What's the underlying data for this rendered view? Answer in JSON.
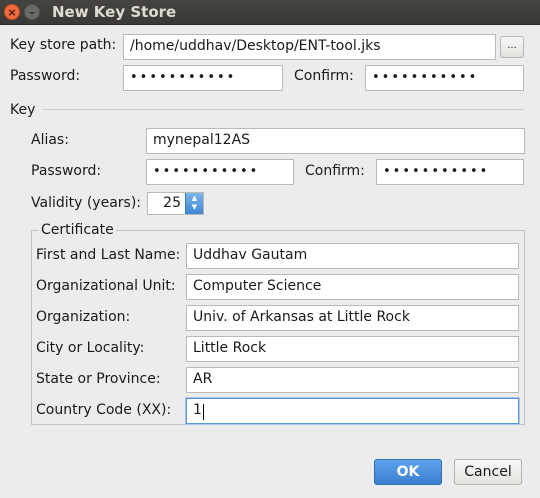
{
  "window": {
    "title": "New Key Store",
    "close_glyph": "×",
    "minimize_glyph": "–"
  },
  "keystore": {
    "path_label": "Key store path:",
    "path_value": "/home/uddhav/Desktop/ENT-tool.jks",
    "browse_label": "...",
    "password_label": "Password:",
    "password_value": "•••••••••••",
    "confirm_label": "Confirm:",
    "confirm_value": "•••••••••••"
  },
  "key": {
    "section_label": "Key",
    "alias_label": "Alias:",
    "alias_value": "mynepal12AS",
    "password_label": "Password:",
    "password_value": "•••••••••••",
    "confirm_label": "Confirm:",
    "confirm_value": "•••••••••••",
    "validity_label": "Validity (years):",
    "validity_value": "25",
    "spin_up": "▲",
    "spin_down": "▼"
  },
  "certificate": {
    "section_label": "Certificate",
    "fields": [
      {
        "label": "First and Last Name:",
        "value": "Uddhav Gautam"
      },
      {
        "label": "Organizational Unit:",
        "value": "Computer Science"
      },
      {
        "label": "Organization:",
        "value": "Univ. of Arkansas at Little Rock"
      },
      {
        "label": "City or Locality:",
        "value": "Little Rock"
      },
      {
        "label": "State or Province:",
        "value": "AR"
      },
      {
        "label": "Country Code (XX):",
        "value": "1"
      }
    ]
  },
  "buttons": {
    "ok": "OK",
    "cancel": "Cancel"
  },
  "colors": {
    "accent": "#3a80d0",
    "titlebar": "#3a3935",
    "close": "#ef6a3c"
  }
}
